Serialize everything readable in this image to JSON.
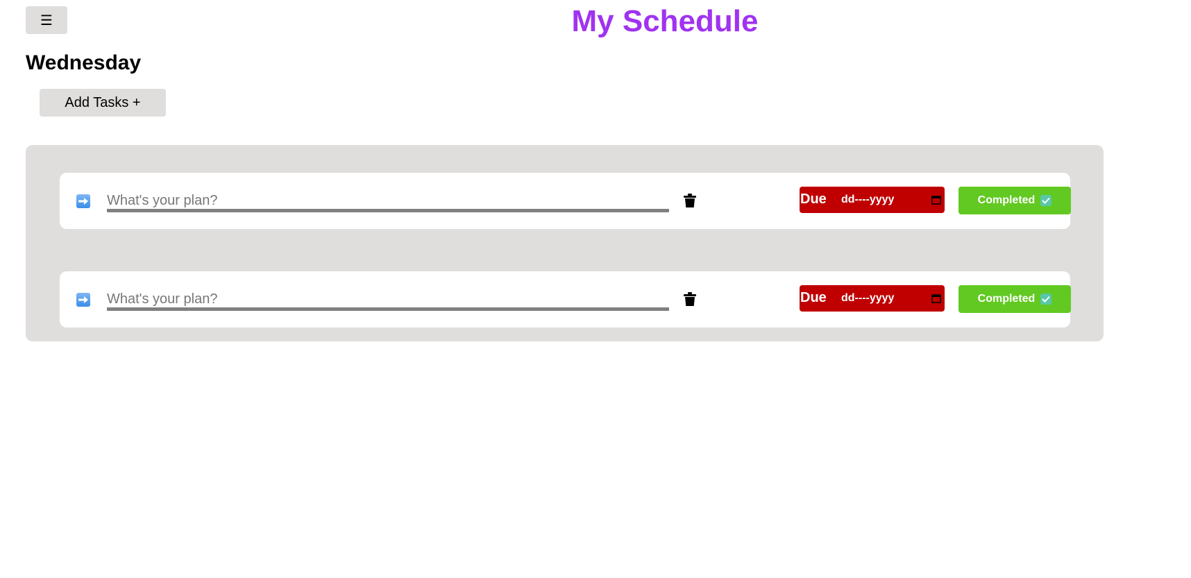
{
  "header": {
    "menu_icon": "hamburger-icon",
    "menu_glyph": "☰",
    "title": "My Schedule"
  },
  "day": {
    "heading": "Wednesday",
    "add_button_label": "Add Tasks +"
  },
  "colors": {
    "title": "#a033f0",
    "panel_bg": "#e0dddd",
    "due_bg": "#c00000",
    "completed_bg": "#62c922"
  },
  "tasks": [
    {
      "arrow_icon": "right-arrow-icon",
      "placeholder": "What's your plan?",
      "value": "",
      "delete_icon": "trash-icon",
      "due_label": "Due",
      "due_date": "dd----yyyy",
      "calendar_icon": "calendar-icon",
      "completed_label": "Completed",
      "completed_icon": "check-icon"
    },
    {
      "arrow_icon": "right-arrow-icon",
      "placeholder": "What's your plan?",
      "value": "",
      "delete_icon": "trash-icon",
      "due_label": "Due",
      "due_date": "dd----yyyy",
      "calendar_icon": "calendar-icon",
      "completed_label": "Completed",
      "completed_icon": "check-icon"
    }
  ]
}
